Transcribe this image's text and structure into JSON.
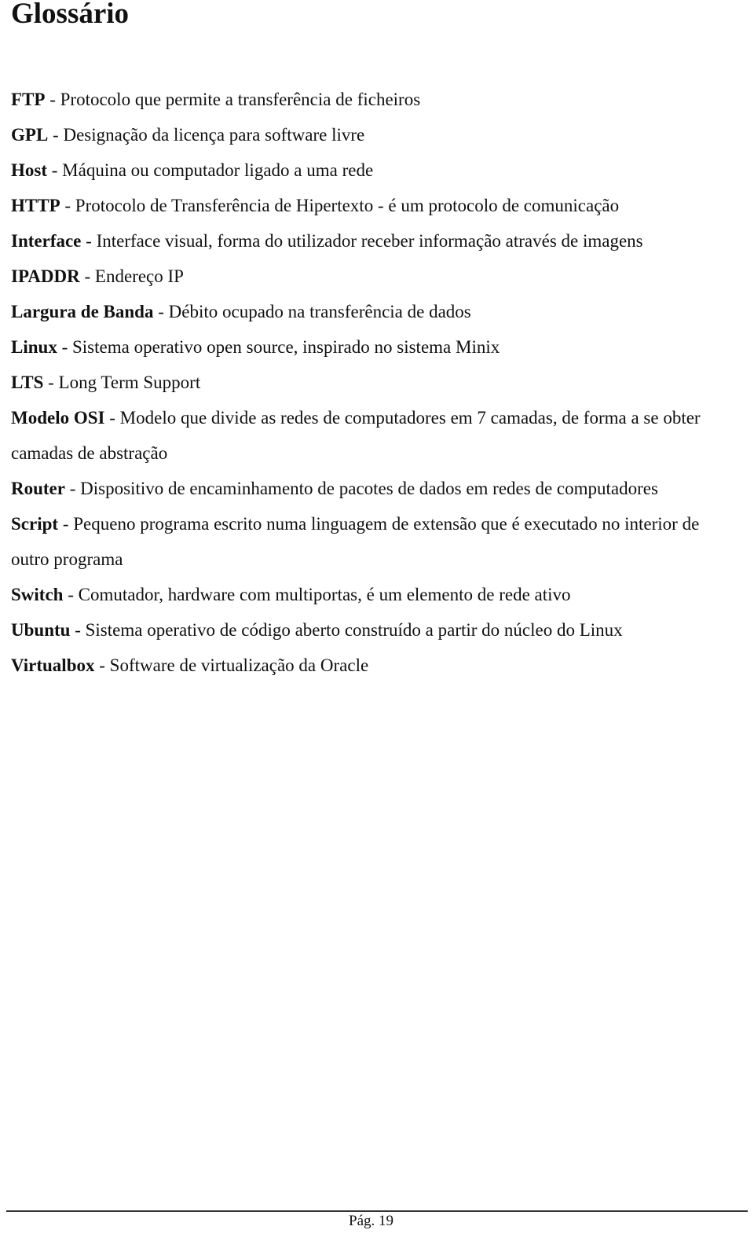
{
  "title": "Glossário",
  "separator": " - ",
  "entries": [
    {
      "term": "FTP",
      "definition": "Protocolo que permite a transferência de ficheiros"
    },
    {
      "term": "GPL",
      "definition": "Designação da licença para software livre"
    },
    {
      "term": "Host",
      "definition": "Máquina ou computador ligado a uma rede"
    },
    {
      "term": "HTTP",
      "definition": "Protocolo de Transferência de Hipertexto - é um protocolo de comunicação"
    },
    {
      "term": "Interface",
      "definition": "Interface visual, forma do utilizador receber informação através de imagens"
    },
    {
      "term": "IPADDR",
      "definition": "Endereço IP"
    },
    {
      "term": "Largura de Banda",
      "definition": "Débito ocupado na transferência de dados"
    },
    {
      "term": "Linux",
      "definition": "Sistema operativo open source, inspirado no sistema Minix"
    },
    {
      "term": "LTS",
      "definition": "Long Term Support"
    },
    {
      "term": "Modelo OSI",
      "definition": "Modelo que divide as redes de computadores em 7 camadas, de forma a se obter camadas de abstração"
    },
    {
      "term": "Router",
      "definition": "Dispositivo de encaminhamento de pacotes de dados em redes de computadores"
    },
    {
      "term": "Script",
      "definition": "Pequeno programa escrito numa linguagem de extensão que é executado no interior de outro programa"
    },
    {
      "term": "Switch",
      "definition": "Comutador, hardware com multiportas, é um elemento de rede ativo"
    },
    {
      "term": "Ubuntu",
      "definition": "Sistema operativo de código aberto construído a partir do núcleo do Linux"
    },
    {
      "term": "Virtualbox",
      "definition": "Software de virtualização da Oracle"
    }
  ],
  "footer": {
    "page_label": "Pág. 19"
  }
}
